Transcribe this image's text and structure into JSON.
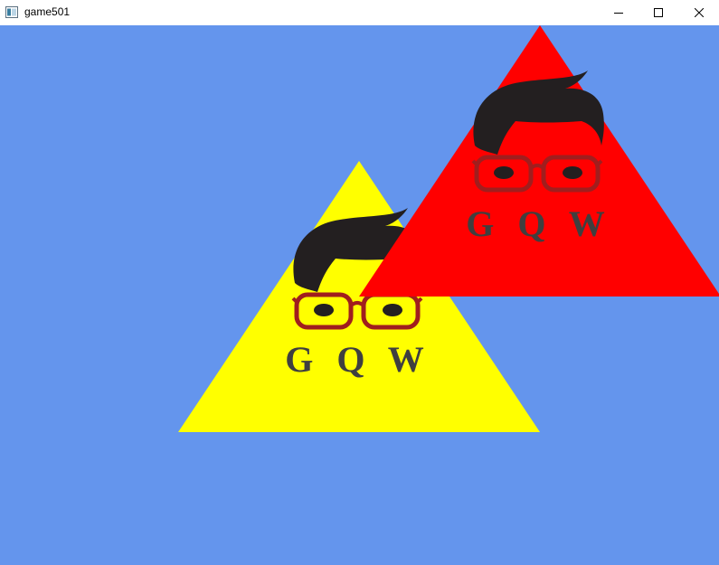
{
  "window": {
    "title": "game501",
    "icon": "app-window-icon",
    "controls": [
      "minimize-icon",
      "maximize-icon",
      "close-icon"
    ]
  },
  "scene": {
    "background_color": "#6495ed",
    "triangles": [
      {
        "name": "yellow-triangle",
        "color": "#ffff00",
        "logo": {
          "text": "G Q W",
          "icon": "boy-with-glasses-logo"
        }
      },
      {
        "name": "red-triangle",
        "color": "#ff0000",
        "logo": {
          "text": "G Q W",
          "icon": "boy-with-glasses-logo"
        }
      }
    ]
  }
}
